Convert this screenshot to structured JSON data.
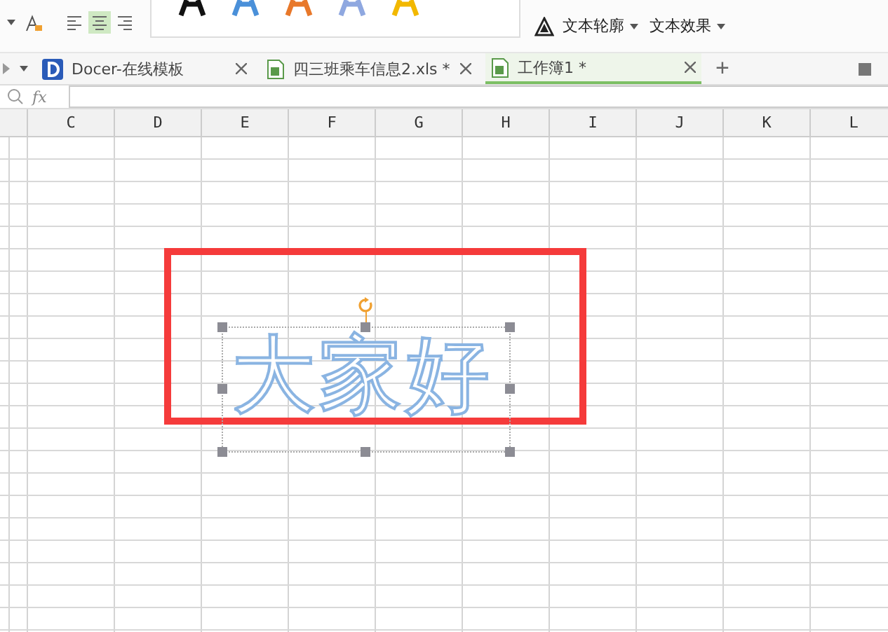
{
  "ribbon": {
    "align_buttons": [
      {
        "kind": "left",
        "selected": false
      },
      {
        "kind": "center",
        "selected": true
      },
      {
        "kind": "right",
        "selected": false
      }
    ],
    "wordart_styles": [
      {
        "color": "#111111"
      },
      {
        "color": "#4a90d9"
      },
      {
        "color": "#e8782a"
      },
      {
        "color": "#8fa8e0"
      },
      {
        "color": "#f2b800"
      }
    ],
    "commands": [
      {
        "label": "文本轮廓"
      },
      {
        "label": "文本效果"
      }
    ]
  },
  "tabs": [
    {
      "label": "Docer-在线模板",
      "kind": "docer",
      "selected": false
    },
    {
      "label": "四三班乘车信息2.xls *",
      "kind": "sheet",
      "selected": false
    },
    {
      "label": "工作簿1 *",
      "kind": "sheet",
      "selected": true
    }
  ],
  "new_tab": "+",
  "formula_bar": {
    "fx": "fx"
  },
  "columns": [
    "C",
    "D",
    "E",
    "F",
    "G",
    "H",
    "I",
    "J",
    "K",
    "L"
  ],
  "wordart": {
    "text": "大家好"
  }
}
